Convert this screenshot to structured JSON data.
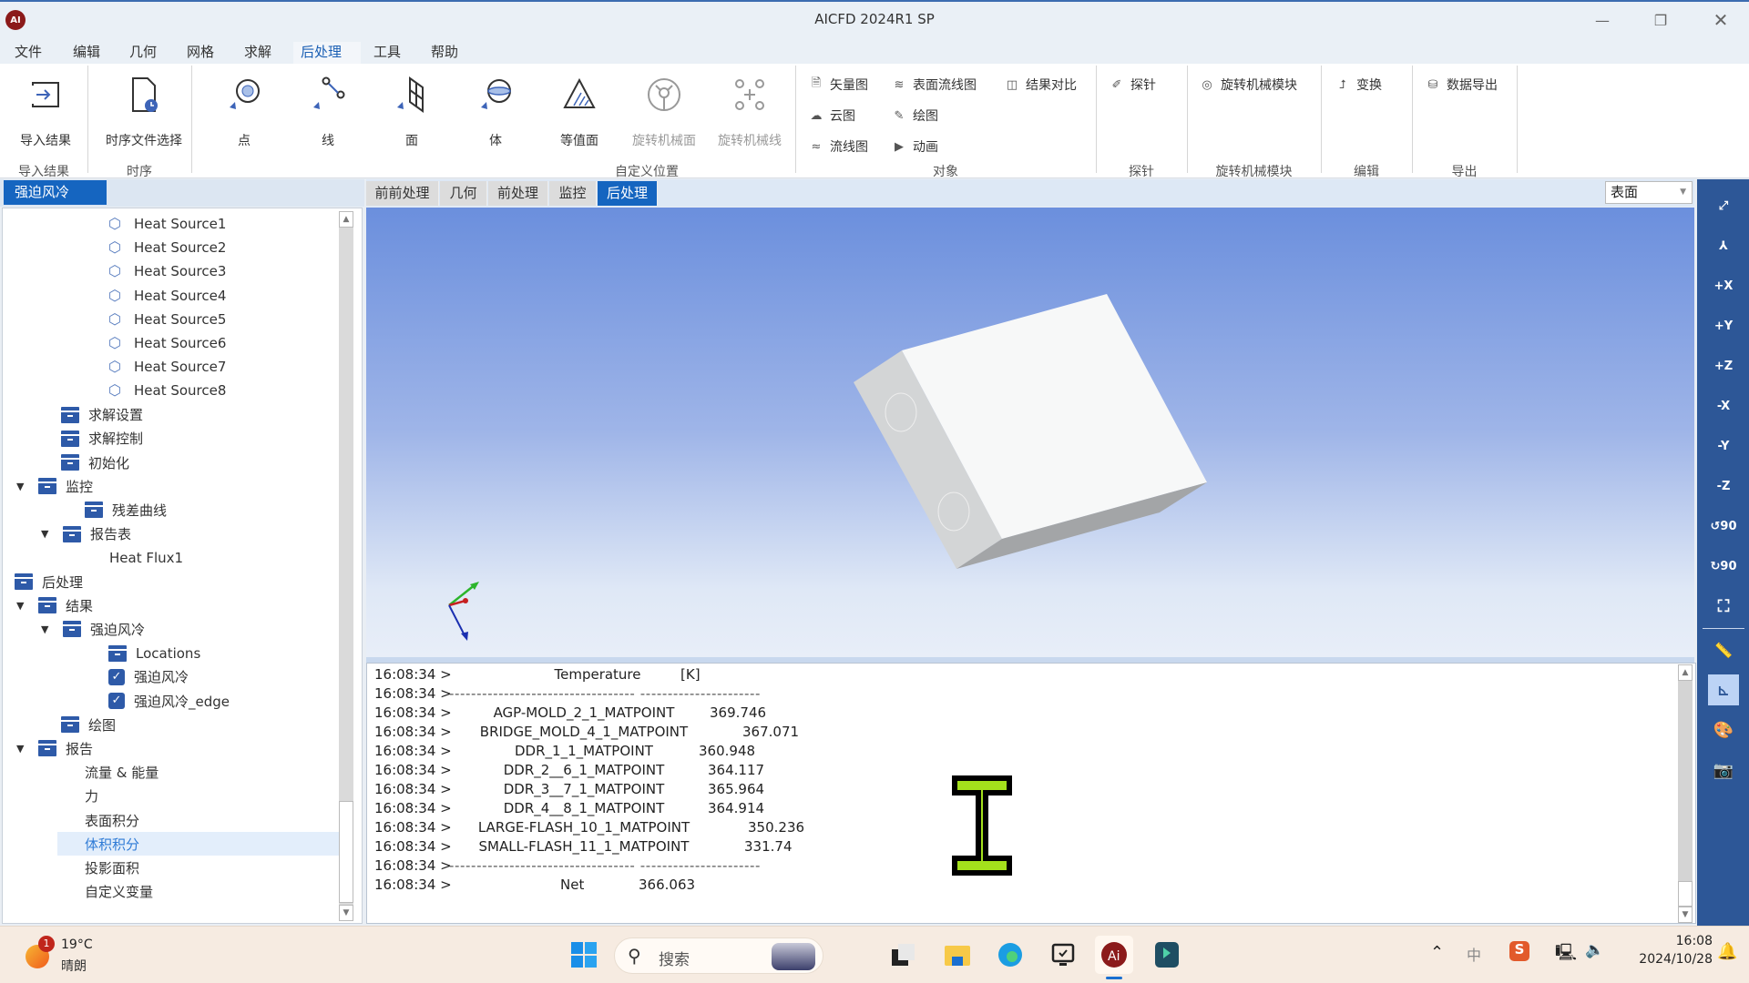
{
  "window": {
    "title": "AICFD 2024R1 SP",
    "logo": "AI"
  },
  "menu": [
    {
      "label": "文件"
    },
    {
      "label": "编辑"
    },
    {
      "label": "几何"
    },
    {
      "label": "网格"
    },
    {
      "label": "求解"
    },
    {
      "label": "后处理",
      "active": true
    },
    {
      "label": "工具"
    },
    {
      "label": "帮助"
    }
  ],
  "ribbon": {
    "import_results": {
      "button": "导入结果",
      "group": "导入结果"
    },
    "timing": {
      "button": "时序文件选择",
      "group": "时序"
    },
    "custom_location": {
      "group": "自定义位置",
      "buttons": [
        "点",
        "线",
        "面",
        "体",
        "等值面",
        "旋转机械面",
        "旋转机械线"
      ]
    },
    "objects": {
      "group": "对象",
      "buttons": [
        "矢量图",
        "表面流线图",
        "结果对比",
        "云图",
        "绘图",
        "流线图",
        "动画"
      ]
    },
    "probe": {
      "group": "探针",
      "button": "探针"
    },
    "turbo": {
      "group": "旋转机械模块",
      "button": "旋转机械模块"
    },
    "edit": {
      "group": "编辑",
      "button": "变换"
    },
    "export": {
      "group": "导出",
      "button": "数据导出"
    }
  },
  "left_panel": {
    "tab": "强迫风冷",
    "tree": [
      "Heat Source1",
      "Heat Source2",
      "Heat Source3",
      "Heat Source4",
      "Heat Source5",
      "Heat Source6",
      "Heat Source7",
      "Heat Source8",
      "求解设置",
      "求解控制",
      "初始化",
      "监控",
      "残差曲线",
      "报告表",
      "Heat Flux1",
      "后处理",
      "结果",
      "强迫风冷",
      "Locations",
      "强迫风冷",
      "强迫风冷_edge",
      "绘图",
      "报告",
      "流量 & 能量",
      "力",
      "表面积分",
      "体积积分",
      "投影面积",
      "自定义变量"
    ],
    "selected": "体积积分"
  },
  "view_tabs": [
    "前前处理",
    "几何",
    "前处理",
    "监控",
    "后处理"
  ],
  "active_view_tab": "后处理",
  "view_select": {
    "value": "表面"
  },
  "console": {
    "timestamp": "16:08:34 >",
    "header": {
      "name": "Temperature",
      "unit": "[K]"
    },
    "separator": "---------------------------------- ----------------------",
    "rows": [
      {
        "name": "AGP-MOLD_2_1_MATPOINT",
        "value": "369.746"
      },
      {
        "name": "BRIDGE_MOLD_4_1_MATPOINT",
        "value": "367.071"
      },
      {
        "name": "DDR_1_1_MATPOINT",
        "value": "360.948"
      },
      {
        "name": "DDR_2__6_1_MATPOINT",
        "value": "364.117"
      },
      {
        "name": "DDR_3__7_1_MATPOINT",
        "value": "365.964"
      },
      {
        "name": "DDR_4__8_1_MATPOINT",
        "value": "364.914"
      },
      {
        "name": "LARGE-FLASH_10_1_MATPOINT",
        "value": "350.236"
      },
      {
        "name": "SMALL-FLASH_11_1_MATPOINT",
        "value": "331.74"
      }
    ],
    "net": {
      "label": "Net",
      "value": "366.063"
    }
  },
  "right_toolbar": [
    "fit-window",
    "axes-triad",
    "+X",
    "+Y",
    "+Z",
    "-X",
    "-Y",
    "-Z",
    "rotate-ccw-90",
    "rotate-cw-90",
    "fullscreen",
    "ruler",
    "hide-axes",
    "palette",
    "camera"
  ],
  "taskbar": {
    "weather": {
      "temp": "19°C",
      "desc": "晴朗",
      "badge": "1"
    },
    "search_placeholder": "搜索",
    "tray": {
      "ime": "中",
      "time": "16:08",
      "date": "2024/10/28"
    }
  }
}
